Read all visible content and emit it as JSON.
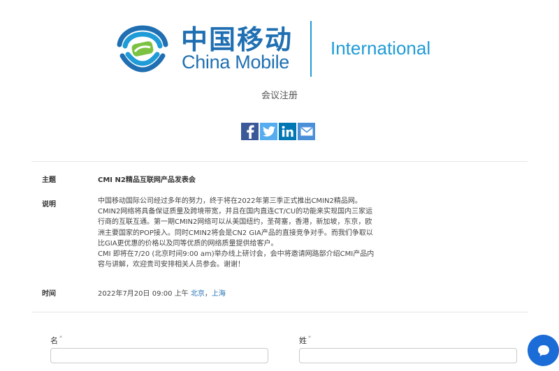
{
  "brand": {
    "name_cn": "中国移动",
    "name_en": "China Mobile",
    "division": "International",
    "colors": {
      "primary": "#1f6fb2",
      "accent": "#1f9bd7",
      "green": "#7cc242"
    }
  },
  "page": {
    "subtitle": "会议注册"
  },
  "share": [
    {
      "icon": "facebook-icon",
      "color": "#3b5998"
    },
    {
      "icon": "twitter-icon",
      "color": "#55acee"
    },
    {
      "icon": "linkedin-icon",
      "color": "#0077b5"
    },
    {
      "icon": "email-icon",
      "color": "#4a90d9"
    }
  ],
  "event": {
    "topic_label": "主题",
    "topic": "CMI N2精品互联网产品发表会",
    "desc_label": "说明",
    "description_lines": [
      "中国移动国际公司经过多年的努力，终于将在2022年第三季正式推出CMIN2精品网。",
      "CMIN2网络将具备保证质量及跨境带宽，并且在国内直连CT/CU的功能来实现国内三家运",
      "行商的互联互通。第一期CMIN2网络可以从美国纽约，圣荷塞，香港，新加坡，东京，欧",
      "洲主要国家的POP接入。同时CMIN2将会是CN2 GIA产品的直接竞争对手。而我们争取以",
      "比GIA更优惠的价格以及同等优质的网络质量提供给客户。",
      "CMI 即将在7/20 (北京时间9:00 am)举办线上研讨会，会中将邀请网路部介绍CMI产品内",
      "容与讲解，欢迎贵司安排相关人员参会。谢谢！"
    ],
    "time_label": "时间",
    "time_text": "2022年7月20日 09:00 上午",
    "time_zone_1": "北京",
    "time_zone_sep": "，",
    "time_zone_2": "上海"
  },
  "form": {
    "first_name_label": "名",
    "last_name_label": "姓",
    "required_mark": "*",
    "first_name_value": "",
    "last_name_value": ""
  },
  "chat": {
    "icon": "chat-icon",
    "color": "#1b6cd6"
  }
}
